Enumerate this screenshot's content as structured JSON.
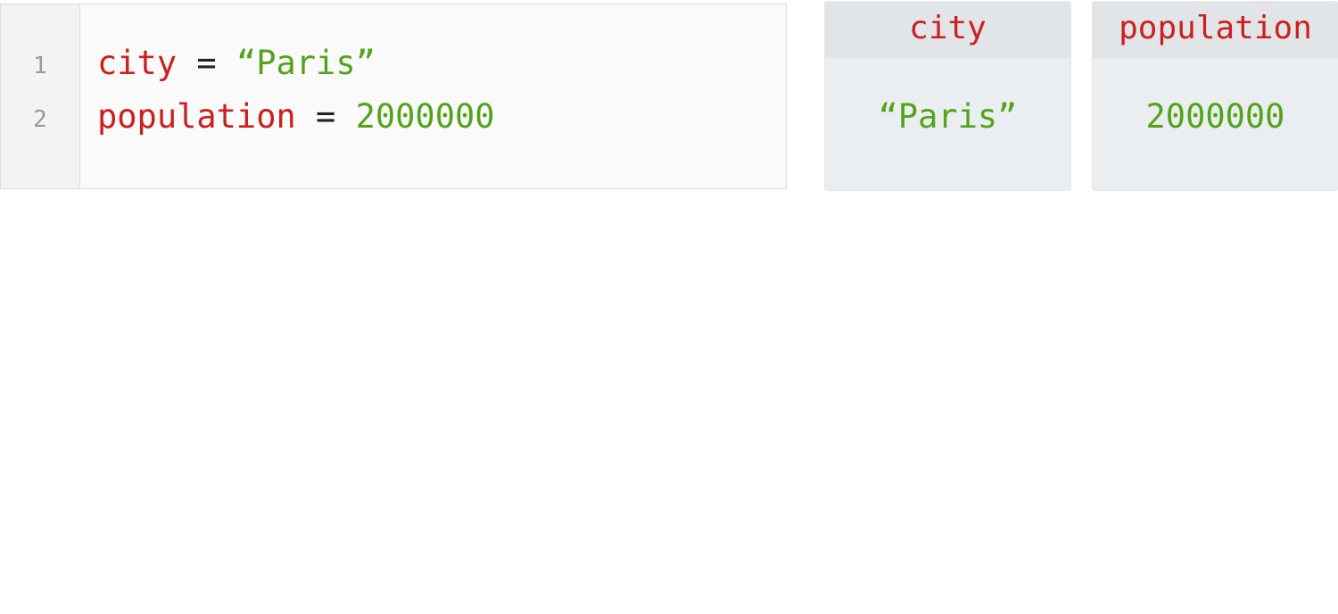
{
  "editor": {
    "lines": [
      {
        "number": "1",
        "name": "city",
        "op": "=",
        "value": "“Paris”"
      },
      {
        "number": "2",
        "name": "population",
        "op": "=",
        "value": "2000000"
      }
    ]
  },
  "variables": [
    {
      "name": "city",
      "value": "“Paris”"
    },
    {
      "name": "population",
      "value": "2000000"
    }
  ],
  "colors": {
    "name": "#cc1f1f",
    "value": "#53a319"
  }
}
